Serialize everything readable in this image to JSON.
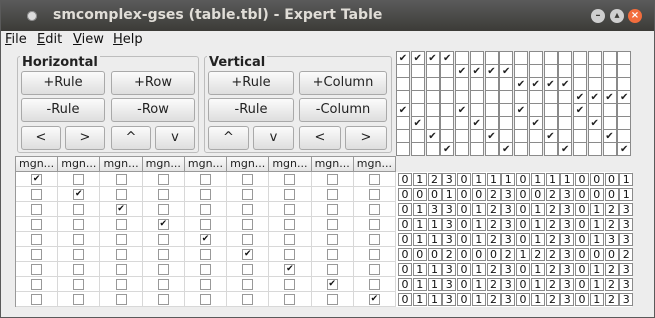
{
  "window": {
    "title": "smcomplex-gses (table.tbl) - Expert Table"
  },
  "menu": [
    {
      "label": "File",
      "key": "F",
      "rest": "ile"
    },
    {
      "label": "Edit",
      "key": "E",
      "rest": "dit"
    },
    {
      "label": "View",
      "key": "V",
      "rest": "iew"
    },
    {
      "label": "Help",
      "key": "H",
      "rest": "elp"
    }
  ],
  "horizontal": {
    "title": "Horizontal",
    "add_rule": "+Rule",
    "add_row": "+Row",
    "remove_rule": "-Rule",
    "remove_row": "-Row",
    "left": "<",
    "right": ">",
    "up": "^",
    "down": "v"
  },
  "vertical": {
    "title": "Vertical",
    "add_rule": "+Rule",
    "add_column": "+Column",
    "remove_rule": "-Rule",
    "remove_column": "-Column",
    "up": "^",
    "down": "v",
    "left": "<",
    "right": ">"
  },
  "column_headers": [
    "mgn...",
    "mgn...",
    "mgn...",
    "mgn...",
    "mgn...",
    "mgn...",
    "mgn...",
    "mgn...",
    "mgn..."
  ],
  "vertical_rules": [
    [
      1,
      1,
      1,
      1,
      0,
      0,
      0,
      0,
      0,
      0,
      0,
      0,
      0,
      0,
      0,
      0
    ],
    [
      0,
      0,
      0,
      0,
      1,
      1,
      1,
      1,
      0,
      0,
      0,
      0,
      0,
      0,
      0,
      0
    ],
    [
      0,
      0,
      0,
      0,
      0,
      0,
      0,
      0,
      1,
      1,
      1,
      1,
      0,
      0,
      0,
      0
    ],
    [
      0,
      0,
      0,
      0,
      0,
      0,
      0,
      0,
      0,
      0,
      0,
      0,
      1,
      1,
      1,
      1
    ],
    [
      1,
      0,
      0,
      0,
      1,
      0,
      0,
      0,
      1,
      0,
      0,
      0,
      1,
      0,
      0,
      0
    ],
    [
      0,
      1,
      0,
      0,
      0,
      1,
      0,
      0,
      0,
      1,
      0,
      0,
      0,
      1,
      0,
      0
    ],
    [
      0,
      0,
      1,
      0,
      0,
      0,
      1,
      0,
      0,
      0,
      1,
      0,
      0,
      0,
      1,
      0
    ],
    [
      0,
      0,
      0,
      1,
      0,
      0,
      0,
      1,
      0,
      0,
      0,
      1,
      0,
      0,
      0,
      1
    ]
  ],
  "row_checks": [
    0,
    1,
    2,
    3,
    4,
    5,
    6,
    7,
    8
  ],
  "table_values": [
    [
      0,
      1,
      2,
      3,
      0,
      1,
      1,
      1,
      0,
      1,
      1,
      1,
      0,
      0,
      0,
      1
    ],
    [
      0,
      0,
      0,
      1,
      0,
      0,
      2,
      3,
      0,
      0,
      2,
      3,
      0,
      0,
      0,
      1
    ],
    [
      0,
      1,
      3,
      3,
      0,
      1,
      2,
      3,
      0,
      1,
      2,
      3,
      0,
      1,
      2,
      3
    ],
    [
      0,
      1,
      1,
      3,
      0,
      1,
      2,
      3,
      0,
      1,
      2,
      3,
      0,
      1,
      2,
      3
    ],
    [
      0,
      1,
      1,
      3,
      0,
      1,
      2,
      3,
      0,
      1,
      2,
      3,
      0,
      1,
      3,
      3
    ],
    [
      0,
      0,
      0,
      2,
      0,
      0,
      0,
      2,
      1,
      2,
      2,
      3,
      0,
      0,
      0,
      2
    ],
    [
      0,
      1,
      1,
      3,
      0,
      1,
      2,
      3,
      0,
      1,
      2,
      3,
      0,
      1,
      2,
      3
    ],
    [
      0,
      1,
      1,
      3,
      0,
      1,
      2,
      3,
      0,
      1,
      2,
      3,
      0,
      1,
      2,
      3
    ],
    [
      0,
      1,
      1,
      3,
      0,
      1,
      2,
      3,
      0,
      1,
      2,
      3,
      0,
      1,
      2,
      3
    ]
  ],
  "overflow_marker": "...",
  "colors": {
    "titlebar": "#3c3b37",
    "close": "#f26d3d",
    "background": "#ededed"
  }
}
